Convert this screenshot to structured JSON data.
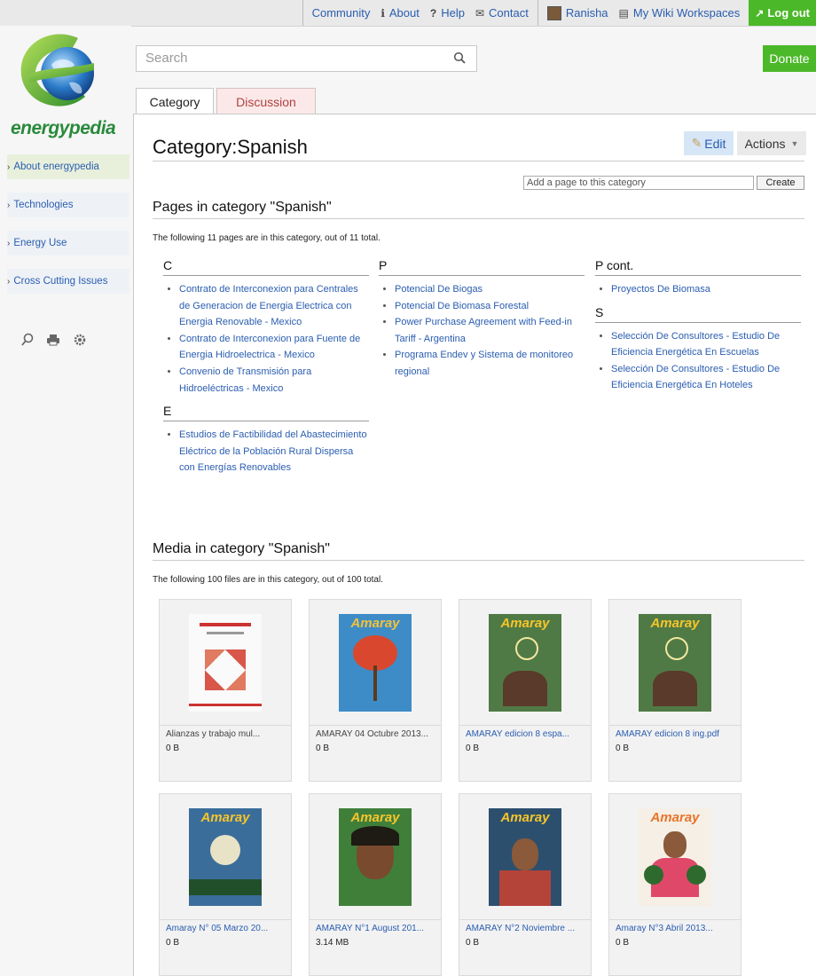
{
  "topbar": {
    "community": "Community",
    "about": "About",
    "help": "Help",
    "contact": "Contact",
    "user": "Ranisha",
    "workspaces": "My Wiki Workspaces",
    "logout": "Log out"
  },
  "brand": {
    "name": "energypedia"
  },
  "sidebar": {
    "items": [
      {
        "label": "About energypedia"
      },
      {
        "label": "Technologies"
      },
      {
        "label": "Energy Use"
      },
      {
        "label": "Cross Cutting Issues"
      }
    ]
  },
  "search": {
    "placeholder": "Search"
  },
  "donate": "Donate",
  "tabs": {
    "category": "Category",
    "discussion": "Discussion"
  },
  "page": {
    "title": "Category:Spanish",
    "edit": "Edit",
    "actions": "Actions",
    "add_placeholder": "Add a page to this category",
    "create": "Create",
    "pages_heading": "Pages in category \"Spanish\"",
    "pages_count": "The following 11 pages are in this category, out of 11 total.",
    "media_heading": "Media in category \"Spanish\"",
    "media_count": "The following 100 files are in this category, out of 100 total."
  },
  "columns": [
    {
      "groups": [
        {
          "letter": "C",
          "items": [
            "Contrato de Interconexion para Centrales de Generacion de Energia Electrica con Energia Renovable - Mexico",
            "Contrato de Interconexion para Fuente de Energia Hidroelectrica - Mexico",
            "Convenio de Transmisión para Hidroeléctricas - Mexico"
          ]
        },
        {
          "letter": "E",
          "items": [
            "Estudios de Factibilidad del Abastecimiento Eléctrico de la Población Rural Dispersa con Energías Renovables"
          ]
        }
      ]
    },
    {
      "groups": [
        {
          "letter": "P",
          "items": [
            "Potencial De Biogas",
            "Potencial De Biomasa Forestal",
            "Power Purchase Agreement with Feed-in Tariff - Argentina",
            "Programa Endev y Sistema de monitoreo regional"
          ]
        }
      ]
    },
    {
      "groups": [
        {
          "letter": "P cont.",
          "items": [
            "Proyectos De Biomasa"
          ]
        },
        {
          "letter": "S",
          "items": [
            "Selección De Consultores - Estudio De Eficiencia Energética En Escuelas",
            "Selección De Consultores - Estudio De Eficiencia Energética En Hoteles"
          ]
        }
      ]
    }
  ],
  "media": [
    {
      "caption": "Alianzas y trabajo mul...",
      "size": "0 B",
      "mast": ""
    },
    {
      "caption": "AMARAY 04 Octubre 2013...",
      "size": "0 B",
      "mast": "Amaray"
    },
    {
      "caption": "AMARAY edicion 8 espa...",
      "size": "0 B",
      "mast": "Amaray"
    },
    {
      "caption": "AMARAY edicion 8 ing.pdf",
      "size": "0 B",
      "mast": "Amaray"
    },
    {
      "caption": "Amaray N° 05 Marzo 20...",
      "size": "0 B",
      "mast": "Amaray"
    },
    {
      "caption": "AMARAY N°1 August 201...",
      "size": "3.14 MB",
      "mast": "Amaray"
    },
    {
      "caption": "AMARAY N°2 Noviembre ...",
      "size": "0 B",
      "mast": "Amaray"
    },
    {
      "caption": "Amaray N°3 Abril 2013...",
      "size": "0 B",
      "mast": "Amaray"
    }
  ],
  "colors": {
    "accent": "#4bb829",
    "link": "#2a5db0"
  }
}
